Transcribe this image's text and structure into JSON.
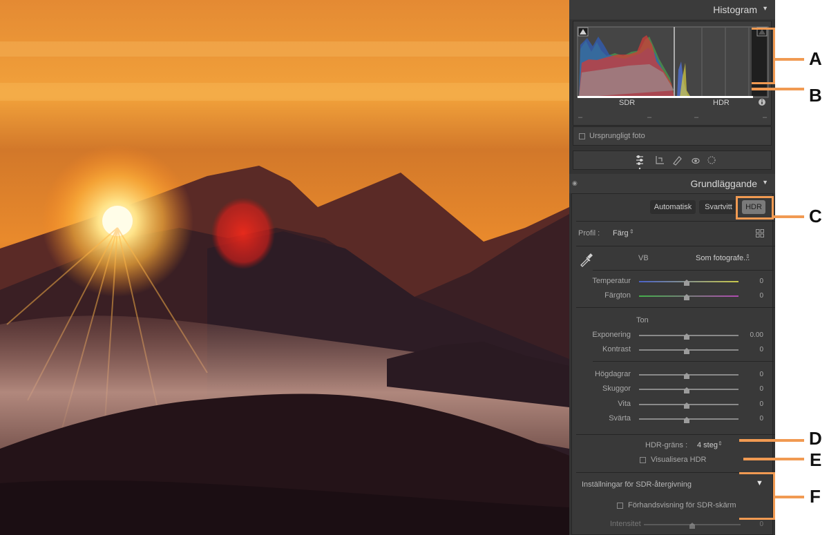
{
  "histogram": {
    "title": "Histogram",
    "sdr_label": "SDR",
    "hdr_label": "HDR",
    "dash1": "–",
    "dash2": "–",
    "dash3": "–",
    "dash4": "–",
    "original_photo": "Ursprungligt foto"
  },
  "basic": {
    "title": "Grundläggande",
    "auto_label": "Automatisk",
    "bw_label": "Svartvitt",
    "hdr_label": "HDR",
    "profile_label": "Profil :",
    "profile_value": "Färg",
    "wb_label": "VB",
    "wb_value": "Som fotografe...",
    "tone_label": "Ton",
    "sliders": [
      {
        "label": "Temperatur",
        "value": "0"
      },
      {
        "label": "Färgton",
        "value": "0"
      },
      {
        "label": "Exponering",
        "value": "0.00"
      },
      {
        "label": "Kontrast",
        "value": "0"
      },
      {
        "label": "Högdagrar",
        "value": "0"
      },
      {
        "label": "Skuggor",
        "value": "0"
      },
      {
        "label": "Vita",
        "value": "0"
      },
      {
        "label": "Svärta",
        "value": "0"
      }
    ],
    "hdr_limit_label": "HDR-gräns :",
    "hdr_limit_value": "4 steg",
    "visualize_label": "Visualisera HDR",
    "sdr_settings_label": "Inställningar för SDR-återgivning",
    "sdr_preview_label": "Förhandsvisning för SDR-skärm",
    "intensity_label": "Intensitet",
    "intensity_value": "0"
  },
  "annotations": [
    "A",
    "B",
    "C",
    "D",
    "E",
    "F"
  ],
  "colors": {
    "accent": "#f19a52",
    "panel_bg": "#333333"
  }
}
